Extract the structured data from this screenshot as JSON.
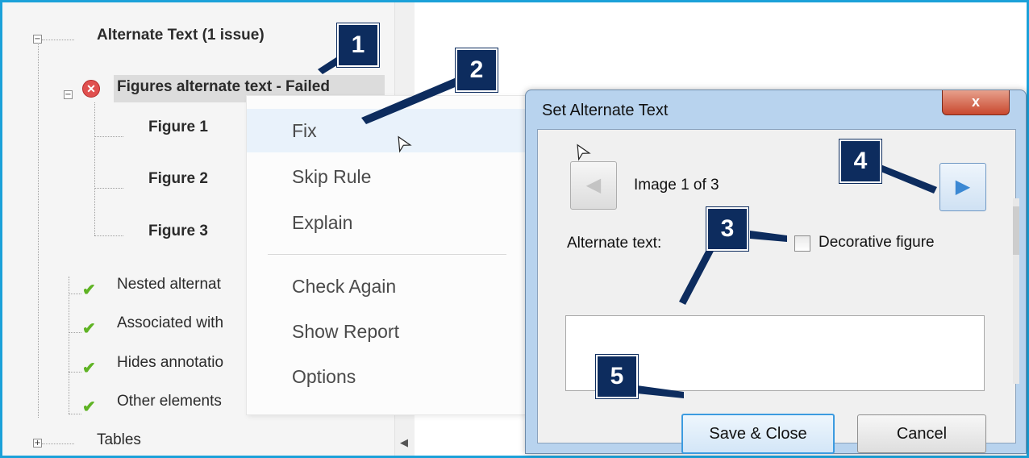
{
  "tree": {
    "group_label": "Alternate Text (1 issue)",
    "failed_rule": "Figures alternate text - Failed",
    "figures": [
      "Figure 1",
      "Figure 2",
      "Figure 3"
    ],
    "passed_rules": [
      "Nested alternat",
      "Associated with",
      "Hides annotatio",
      "Other elements"
    ],
    "tables_label": "Tables",
    "toggle_collapse": "−",
    "toggle_expand": "+",
    "error_glyph": "✕",
    "check_glyph": "✔",
    "scroll_glyph": "◀"
  },
  "context_menu": {
    "items": [
      "Fix",
      "Skip Rule",
      "Explain",
      "Check Again",
      "Show Report",
      "Options"
    ]
  },
  "dialog": {
    "title": "Set Alternate Text",
    "close_glyph": "x",
    "image_counter": "Image 1 of 3",
    "prev_glyph": "◀",
    "next_glyph": "▶",
    "alt_text_label": "Alternate text:",
    "decorative_label": "Decorative figure",
    "alt_text_value": "",
    "save_label": "Save & Close",
    "cancel_label": "Cancel"
  },
  "callouts": [
    "1",
    "2",
    "3",
    "4",
    "5"
  ],
  "colors": {
    "frame": "#1ba1d9",
    "badge": "#0d2c5e",
    "error": "#e0504f",
    "check": "#5fb324"
  }
}
